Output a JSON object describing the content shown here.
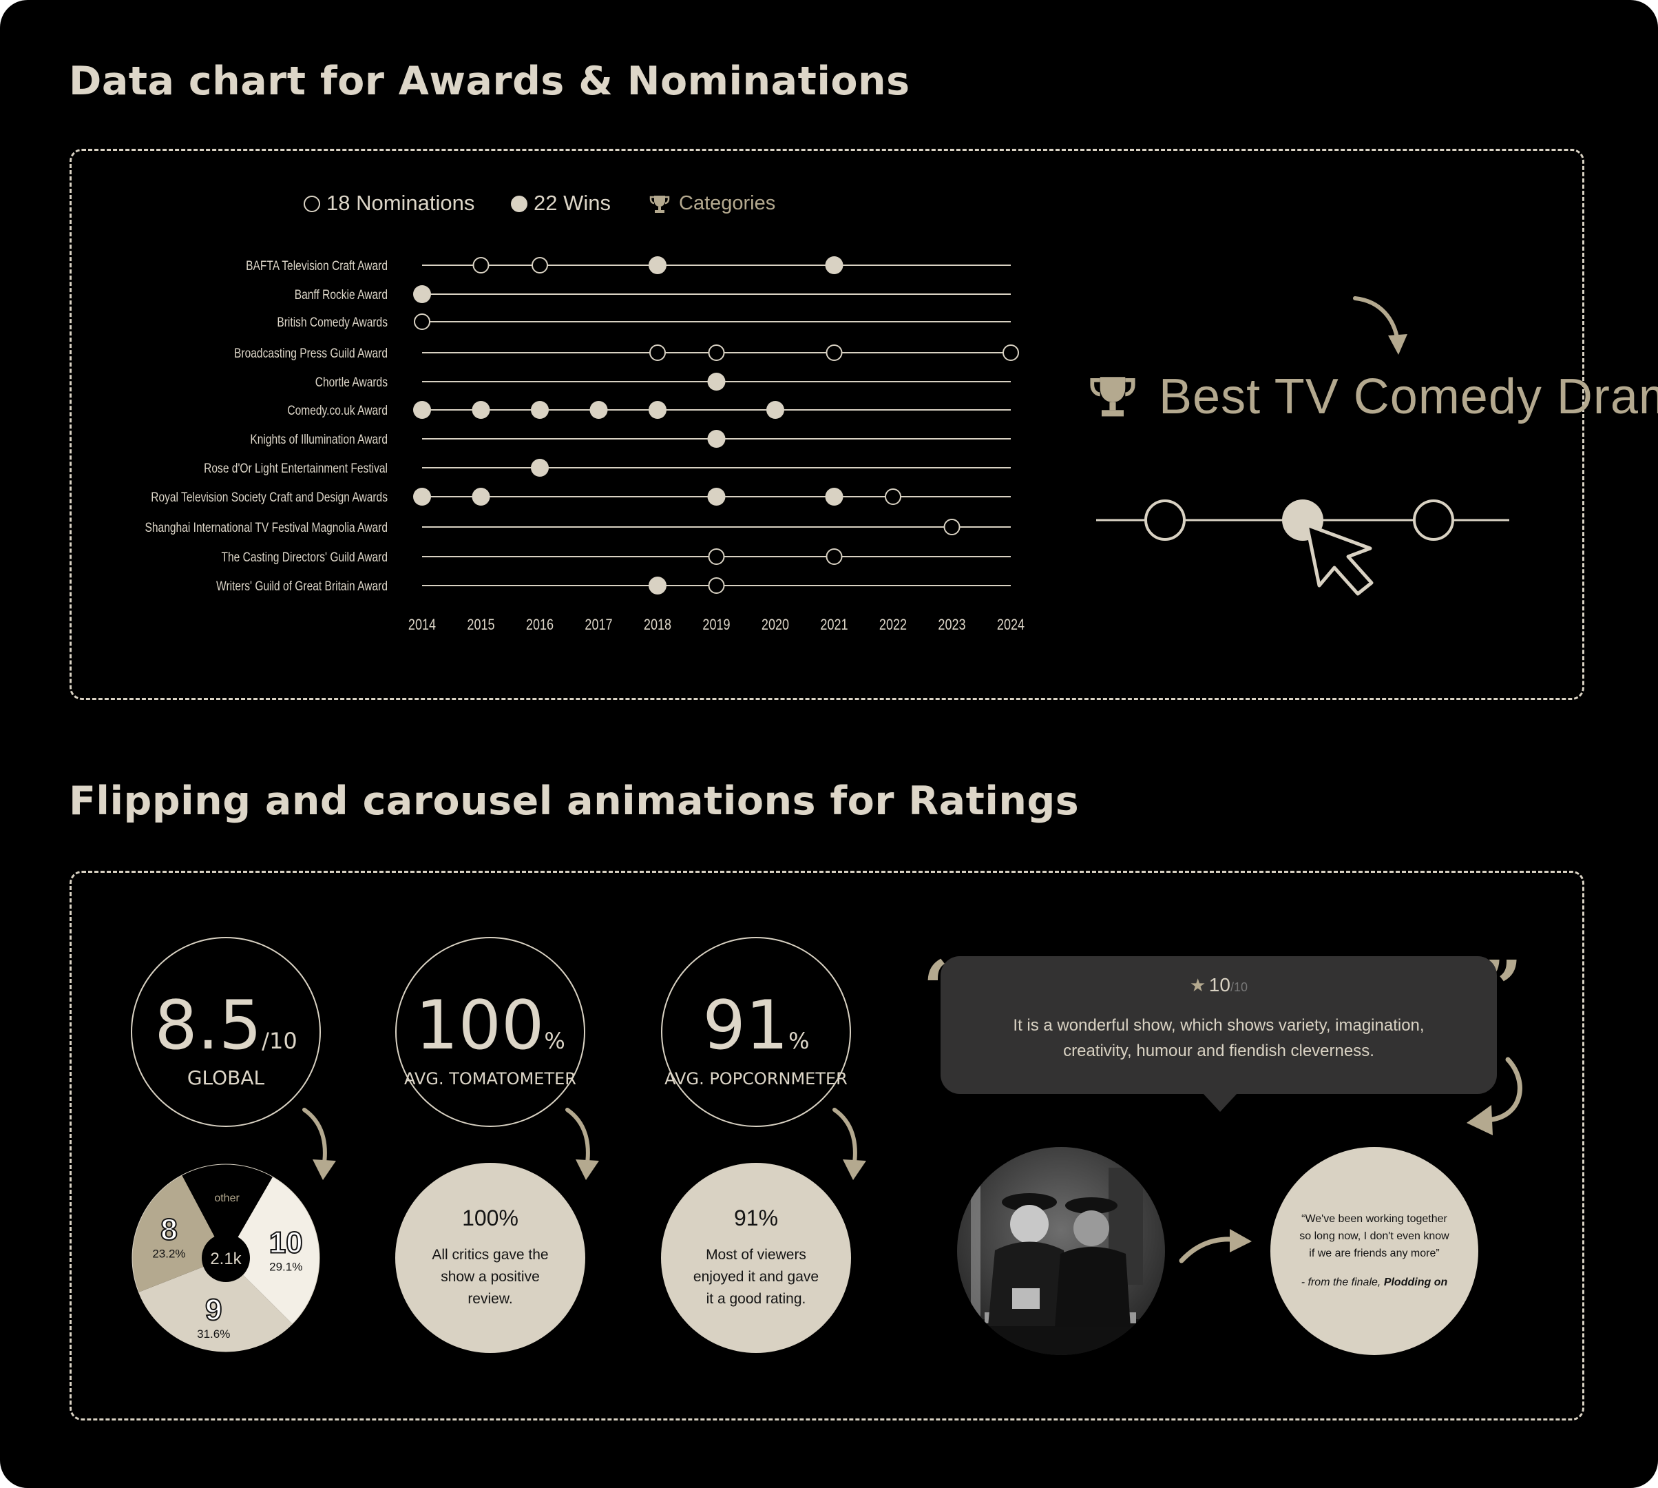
{
  "sections": {
    "awards_title": "Data chart for Awards & Nominations",
    "ratings_title": "Flipping and carousel animations for Ratings"
  },
  "legend": {
    "nominations": "18 Nominations",
    "wins": "22 Wins",
    "categories": "Categories"
  },
  "callout": {
    "category": "Best TV Comedy Drama",
    "icons": [
      "trophy-icon",
      "arrow-curved-icon",
      "cursor-pointer-icon"
    ]
  },
  "chart_data": {
    "type": "scatter",
    "x": [
      2014,
      2015,
      2016,
      2017,
      2018,
      2019,
      2020,
      2021,
      2022,
      2023,
      2024
    ],
    "xlim": [
      2014,
      2024
    ],
    "categories": [
      "BAFTA Television Craft Award",
      "Banff Rockie Award",
      "British Comedy Awards",
      "Broadcasting Press Guild Award",
      "Chortle Awards",
      "Comedy.co.uk Award",
      "Knights of Illumination Award",
      "Rose d'Or Light Entertainment Festival",
      "Royal Television Society Craft and Design Awards",
      "Shanghai International TV Festival Magnolia Award",
      "The Casting Directors' Guild Award",
      "Writers' Guild of Great Britain Award"
    ],
    "series": [
      {
        "name": "Wins",
        "marker": "filled",
        "points": [
          {
            "category": "BAFTA Television Craft Award",
            "year": 2018
          },
          {
            "category": "BAFTA Television Craft Award",
            "year": 2021
          },
          {
            "category": "Banff Rockie Award",
            "year": 2014
          },
          {
            "category": "Chortle Awards",
            "year": 2019
          },
          {
            "category": "Comedy.co.uk Award",
            "year": 2014
          },
          {
            "category": "Comedy.co.uk Award",
            "year": 2015
          },
          {
            "category": "Comedy.co.uk Award",
            "year": 2016
          },
          {
            "category": "Comedy.co.uk Award",
            "year": 2017
          },
          {
            "category": "Comedy.co.uk Award",
            "year": 2018
          },
          {
            "category": "Comedy.co.uk Award",
            "year": 2020
          },
          {
            "category": "Knights of Illumination Award",
            "year": 2019
          },
          {
            "category": "Rose d'Or Light Entertainment Festival",
            "year": 2016
          },
          {
            "category": "Royal Television Society Craft and Design Awards",
            "year": 2014
          },
          {
            "category": "Royal Television Society Craft and Design Awards",
            "year": 2015
          },
          {
            "category": "Royal Television Society Craft and Design Awards",
            "year": 2019
          },
          {
            "category": "Royal Television Society Craft and Design Awards",
            "year": 2021
          },
          {
            "category": "Writers' Guild of Great Britain Award",
            "year": 2018
          }
        ]
      },
      {
        "name": "Nominations",
        "marker": "hollow",
        "points": [
          {
            "category": "BAFTA Television Craft Award",
            "year": 2015
          },
          {
            "category": "BAFTA Television Craft Award",
            "year": 2016
          },
          {
            "category": "British Comedy Awards",
            "year": 2014
          },
          {
            "category": "Broadcasting Press Guild Award",
            "year": 2018
          },
          {
            "category": "Broadcasting Press Guild Award",
            "year": 2019
          },
          {
            "category": "Broadcasting Press Guild Award",
            "year": 2021
          },
          {
            "category": "Broadcasting Press Guild Award",
            "year": 2024
          },
          {
            "category": "Royal Television Society Craft and Design Awards",
            "year": 2022
          },
          {
            "category": "Shanghai International TV Festival Magnolia Award",
            "year": 2023
          },
          {
            "category": "The Casting Directors' Guild Award",
            "year": 2019
          },
          {
            "category": "The Casting Directors' Guild Award",
            "year": 2021
          },
          {
            "category": "Writers' Guild of Great Britain Award",
            "year": 2019
          }
        ]
      }
    ],
    "grid": false,
    "legend": "top"
  },
  "ratings": [
    {
      "value": "8.5",
      "suffix": "/10",
      "label": "GLOBAL"
    },
    {
      "value": "100",
      "suffix": "%",
      "label": "AVG. TOMATOMETER",
      "info_title": "100%",
      "info_text": "All critics gave the show a positive review."
    },
    {
      "value": "91",
      "suffix": "%",
      "label": "AVG. POPCORNMETER",
      "info_title": "91%",
      "info_text": "Most of viewers enjoyed it and gave it a good rating."
    }
  ],
  "distribution": {
    "total": "2.1k",
    "other_label": "other",
    "slices": [
      {
        "label": "10",
        "percent": "29.1%",
        "share": 0.291,
        "color": "#f3efe6"
      },
      {
        "label": "9",
        "percent": "31.6%",
        "share": 0.316,
        "color": "#d9d2c3"
      },
      {
        "label": "8",
        "percent": "23.2%",
        "share": 0.232,
        "color": "#b4a98f"
      },
      {
        "label": "other",
        "percent": "",
        "share": 0.161,
        "color": "#000000"
      }
    ]
  },
  "review": {
    "score": "10",
    "score_suffix": "/10",
    "text_line1": "It is a wonderful show, which shows variety, imagination,",
    "text_line2": "creativity, humour and fiendish cleverness.",
    "open_quote": "“",
    "close_quote": "”"
  },
  "quote": {
    "line1": "“We've been working together",
    "line2": "so long now, I don't even know",
    "line3": "if we are friends any more”",
    "source_prefix": "- from the finale,",
    "source_title": "Plodding on"
  },
  "colors": {
    "background": "#000000",
    "accent": "#d9d2c3",
    "gold": "#b4a98f",
    "bubble": "#333232",
    "text_light": "#ddd6c8"
  }
}
